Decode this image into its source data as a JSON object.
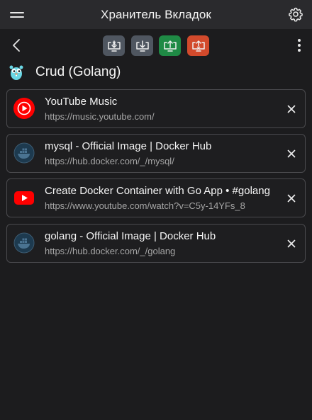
{
  "header": {
    "title": "Хранитель Вкладок",
    "menu_icon": "hamburger-menu-icon",
    "settings_icon": "gear-icon"
  },
  "toolbar": {
    "back_icon": "chevron-left-icon",
    "actions": [
      {
        "icon": "import-close-icon",
        "color": "#4f5660"
      },
      {
        "icon": "import-icon",
        "color": "#4f5660"
      },
      {
        "icon": "export-icon",
        "color": "#1f8a45"
      },
      {
        "icon": "export-close-icon",
        "color": "#d24a2c"
      }
    ],
    "more_icon": "kebab-menu-icon"
  },
  "group": {
    "icon": "gopher-icon",
    "title": "Crud (Golang)"
  },
  "tabs": [
    {
      "title": "YouTube Music",
      "url": "https://music.youtube.com/",
      "icon": "youtube-music-icon"
    },
    {
      "title": "mysql - Official Image | Docker Hub",
      "url": "https://hub.docker.com/_/mysql/",
      "icon": "docker-icon"
    },
    {
      "title": "Create Docker Container with Go App • #golang",
      "url": "https://www.youtube.com/watch?v=C5y-14YFs_8",
      "icon": "youtube-icon"
    },
    {
      "title": "golang - Official Image | Docker Hub",
      "url": "https://hub.docker.com/_/golang",
      "icon": "docker-icon"
    }
  ]
}
